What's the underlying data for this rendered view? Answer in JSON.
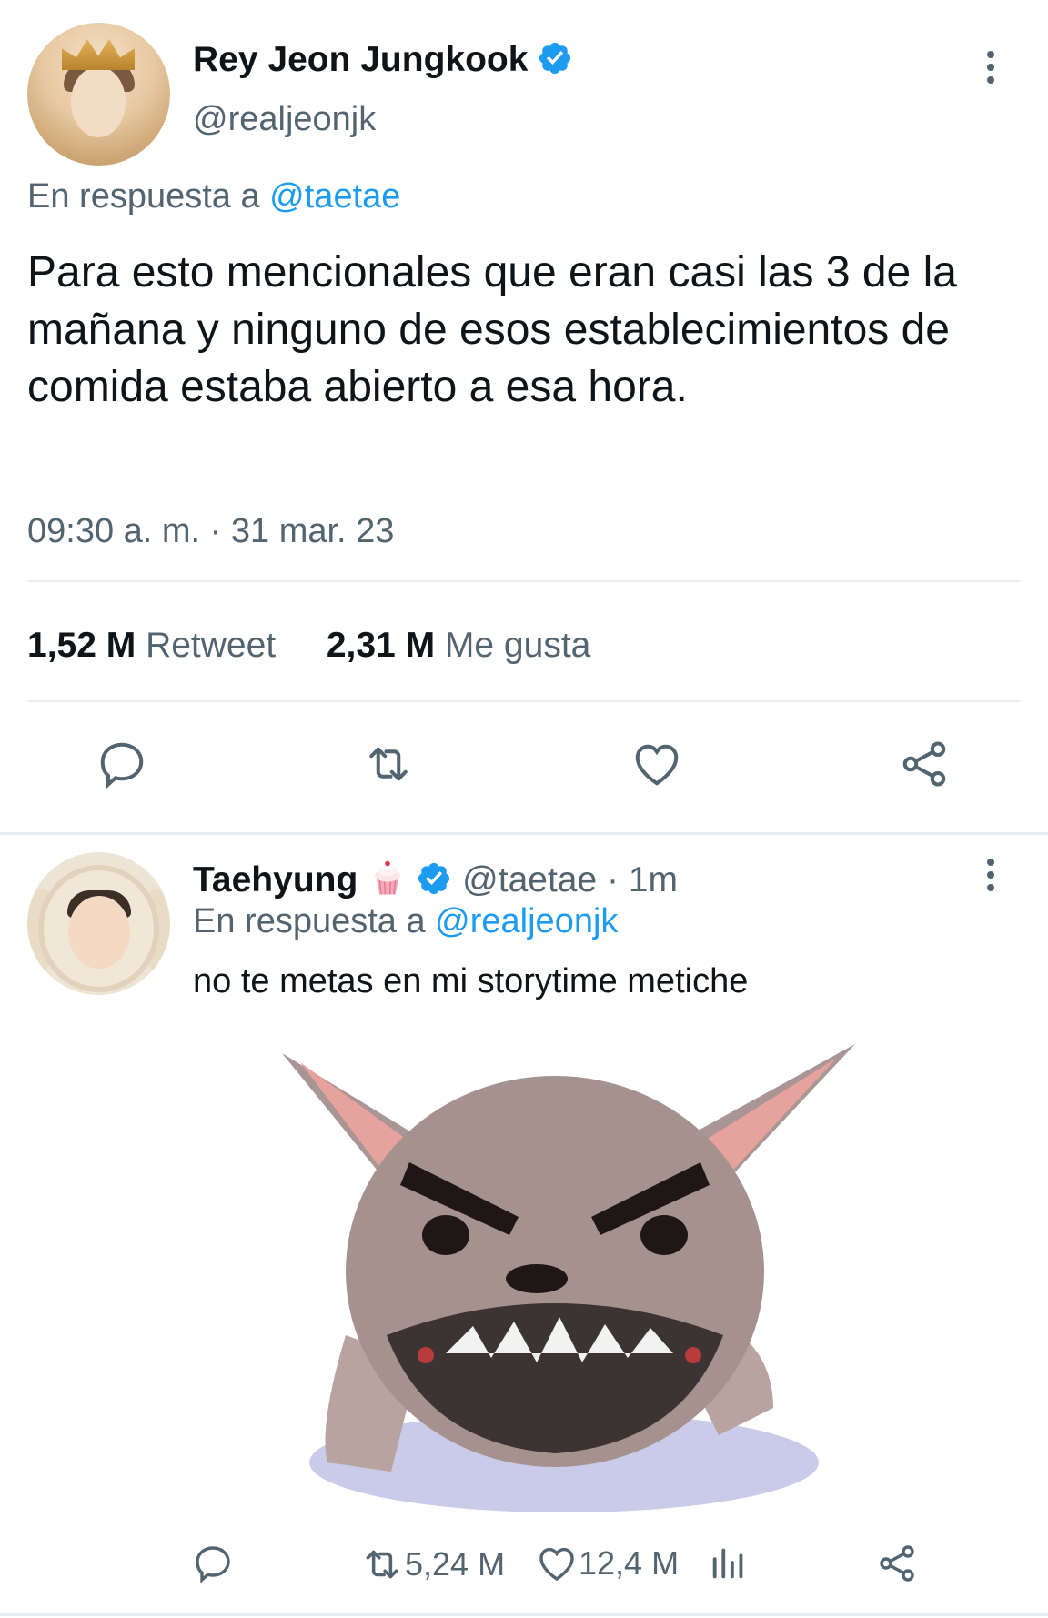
{
  "main_tweet": {
    "display_name": "Rey Jeon Jungkook",
    "handle": "@realjeonjk",
    "reply_prefix": "En respuesta a",
    "reply_to": "@taetae",
    "text": "Para esto mencionales que eran casi las 3 de la mañana y ninguno de esos establecimientos de comida estaba abierto a esa hora.",
    "timestamp": "09:30 a. m. · 31 mar. 23",
    "retweet_count": "1,52 M",
    "retweet_label": "Retweet",
    "like_count": "2,31 M",
    "like_label": "Me gusta"
  },
  "reply_tweet": {
    "display_name": "Taehyung",
    "handle_meta": "@taetae · 1m",
    "reply_prefix": "En respuesta a",
    "reply_to": "@realjeonjk",
    "text": "no te metas en mi storytime metiche",
    "retweet_count": "5,24 M",
    "like_count": "12,4 M"
  },
  "icons": {
    "verified": "verified-badge-icon",
    "more": "more-vertical-icon",
    "reply": "reply-icon",
    "retweet": "retweet-icon",
    "like": "heart-icon",
    "share": "share-icon",
    "analytics": "analytics-icon",
    "cupcake": "cupcake-emoji-icon"
  },
  "colors": {
    "link": "#1d9bf0",
    "secondary_text": "#536471",
    "primary_text": "#0f1419",
    "divider": "#e6ecf0"
  }
}
